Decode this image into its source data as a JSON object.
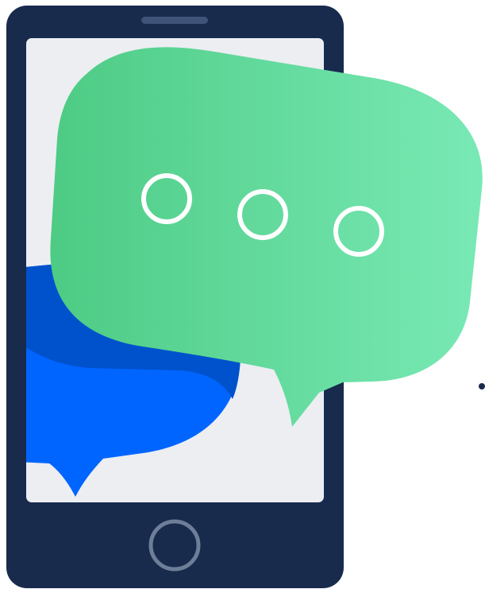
{
  "illustration": {
    "subject": "phone-with-chat-bubbles",
    "icons": [
      "phone-icon",
      "chat-bubble-icon",
      "typing-indicator-icon",
      "home-button-icon"
    ]
  },
  "colors": {
    "phone_body": "#182B4D",
    "screen": "#ECEEF2",
    "speaker": "#3F5277",
    "home_button_ring": "#6E7E98",
    "blue_bubble": "#0065FF",
    "blue_bubble_shadow": "#0052CC",
    "green_bubble_start": "#4DCB84",
    "green_bubble_end": "#79E9B5",
    "typing_dot_ring": "#FFFFFF",
    "accent_dot": "#182B4D"
  },
  "typing_indicator": {
    "dot_count": 3
  }
}
